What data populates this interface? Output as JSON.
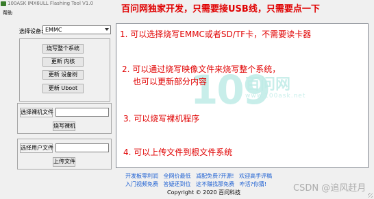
{
  "window": {
    "title": "100ASK IMX6ULL Flashing Tool V1.0",
    "banner": "百问网独家开发，只需要接USB线，只需要点一下"
  },
  "menu": {
    "help": "帮助"
  },
  "device": {
    "label": "选择设备:",
    "selected": "EMMC"
  },
  "flash_group": {
    "flash_all": "烧写整个系统",
    "update_kernel": "更新  内核",
    "update_dtb": "更新  设备树",
    "update_uboot": "更新  Uboot"
  },
  "bare_group": {
    "select_label": "选择裸机文件",
    "file_value": "",
    "flash_bare": "烧写裸机"
  },
  "user_group": {
    "select_label": "选择用户文件",
    "file_value": "",
    "upload": "上传文件"
  },
  "log": {
    "lines": [
      "1. 可以选择烧写EMMC或者SD/TF卡，不需要读卡器",
      "2. 可以通过烧写映像文件来烧写整个系统，",
      "也可以更新部分内容",
      "3. 可以烧写裸机程序",
      "4. 可以上传文件到根文件系统"
    ],
    "watermark": {
      "number": "109",
      "name": "百问网",
      "url": "www.100ask.net"
    }
  },
  "footer": {
    "row1": [
      "开发板零利润",
      "全网价最低",
      "减配免费?开源!",
      "欢迎高手评稿"
    ],
    "row2": [
      "入门视频免费",
      "答疑还到位",
      "这不赚找那免费",
      "咋活?你猜!"
    ],
    "copyright": "Copyright © 2020 百问科技",
    "csdn": "CSDN @追风赶月"
  },
  "colors": {
    "highlight": "#e00000",
    "link": "#1c5fd2",
    "watermark": "#beebe6"
  }
}
